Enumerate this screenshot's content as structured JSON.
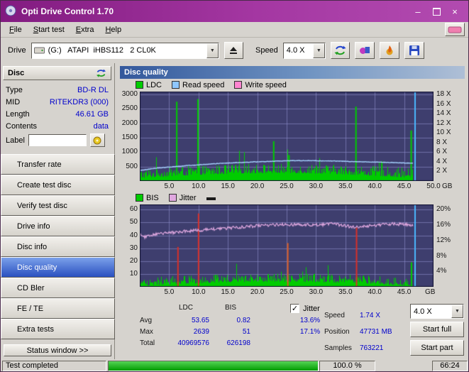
{
  "window": {
    "title": "Opti Drive Control 1.70"
  },
  "icons": {
    "minimize": "–",
    "close": "×",
    "dropdown": "▼",
    "check": "✓"
  },
  "menu": {
    "items": [
      "File",
      "Start test",
      "Extra",
      "Help"
    ]
  },
  "toolbar": {
    "drive_label": "Drive",
    "drive_value": "(G:)   ATAPI  iHBS112   2 CL0K",
    "speed_label": "Speed",
    "speed_value": "4.0 X"
  },
  "sidebar": {
    "header": "Disc",
    "info_rows": [
      {
        "label": "Type",
        "value": "BD-R DL"
      },
      {
        "label": "MID",
        "value": "RITEKDR3 (000)"
      },
      {
        "label": "Length",
        "value": "46.61 GB"
      },
      {
        "label": "Contents",
        "value": "data"
      }
    ],
    "label_row": {
      "label": "Label",
      "value": ""
    },
    "buttons": [
      {
        "label": "Transfer rate",
        "selected": false
      },
      {
        "label": "Create test disc",
        "selected": false
      },
      {
        "label": "Verify test disc",
        "selected": false
      },
      {
        "label": "Drive info",
        "selected": false
      },
      {
        "label": "Disc info",
        "selected": false
      },
      {
        "label": "Disc quality",
        "selected": true
      },
      {
        "label": "CD Bler",
        "selected": false
      },
      {
        "label": "FE / TE",
        "selected": false
      },
      {
        "label": "Extra tests",
        "selected": false
      }
    ],
    "status_window_button": "Status window >>"
  },
  "main": {
    "panel_title": "Disc quality",
    "results": {
      "col_headers": [
        "LDC",
        "BIS"
      ],
      "rows": [
        {
          "label": "Avg",
          "ldc": "53.65",
          "bis": "0.82",
          "jitter": "13.6%"
        },
        {
          "label": "Max",
          "ldc": "2639",
          "bis": "51",
          "jitter": "17.1%"
        },
        {
          "label": "Total",
          "ldc": "40969576",
          "bis": "626198",
          "jitter": ""
        }
      ],
      "jitter_checkbox": {
        "label": "Jitter",
        "checked": true
      },
      "stats": [
        {
          "label": "Speed",
          "value": "1.74 X"
        },
        {
          "label": "Position",
          "value": "47731 MB"
        },
        {
          "label": "Samples",
          "value": "763221"
        }
      ],
      "speed_select": "4.0 X",
      "start_full": "Start full",
      "start_part": "Start part"
    }
  },
  "statusbar": {
    "status": "Test completed",
    "progress_percent": 100,
    "percent_label": "100.0 %",
    "time": "66:24"
  },
  "chart_data": [
    {
      "type": "bar",
      "title": "Disc quality - LDC vs position",
      "legend": [
        {
          "label": "LDC",
          "color": "#00cc00"
        },
        {
          "label": "Read speed",
          "color": "#8fc7ff"
        },
        {
          "label": "Write speed",
          "color": "#ff85d0"
        }
      ],
      "x": {
        "min": 0,
        "max": 50,
        "unit": "GB",
        "ticks": [
          [
            5,
            "5.0"
          ],
          [
            10,
            "10.0"
          ],
          [
            15,
            "15.0"
          ],
          [
            20,
            "20.0"
          ],
          [
            25,
            "25.0"
          ],
          [
            30,
            "30.0"
          ],
          [
            35,
            "35.0"
          ],
          [
            40,
            "40.0"
          ],
          [
            45,
            "45.0"
          ],
          [
            50,
            "50.0"
          ]
        ]
      },
      "y_left": {
        "display_max": 3100,
        "ticks": [
          [
            3000,
            "3000"
          ],
          [
            2500,
            "2500"
          ],
          [
            2000,
            "2000"
          ],
          [
            1500,
            "1500"
          ],
          [
            1000,
            "1000"
          ],
          [
            500,
            "500"
          ]
        ]
      },
      "y_right": {
        "per_left": 166.67,
        "ticks": [
          [
            18,
            "18 X"
          ],
          [
            16,
            "16 X"
          ],
          [
            14,
            "14 X"
          ],
          [
            12,
            "12 X"
          ],
          [
            10,
            "10 X"
          ],
          [
            8,
            "8 X"
          ],
          [
            6,
            "6 X"
          ],
          [
            4,
            "4 X"
          ],
          [
            2,
            "2 X"
          ]
        ]
      },
      "data_end": 46.6,
      "seed": 1234,
      "bars": {
        "color": "#00cc00",
        "base": 110,
        "vary": 330,
        "bump": 170,
        "spikes": [
          [
            6.3,
            2750
          ],
          [
            9.9,
            2840
          ],
          [
            22.8,
            1380
          ],
          [
            25.4,
            900
          ],
          [
            36.8,
            2580
          ],
          [
            41.2,
            680
          ],
          [
            46.2,
            1750
          ]
        ]
      },
      "lines": [
        {
          "name": "read-speed",
          "color": "#a6d2ff",
          "width": 1.4,
          "scale": 166.67,
          "noise": 0.05,
          "x": [
            0,
            3,
            8,
            14,
            20,
            26,
            32,
            38,
            43,
            46.6
          ],
          "v": [
            2.2,
            2.7,
            3.2,
            3.7,
            4.0,
            4.25,
            4.2,
            4.0,
            3.85,
            3.7
          ]
        }
      ],
      "colors": {
        "bg": "#3e3e6e",
        "grid": "rgba(150,150,215,0.55)",
        "end": "#49b8ff"
      }
    },
    {
      "type": "bar",
      "title": "Disc quality - BIS / Jitter vs position",
      "legend": [
        {
          "label": "BIS",
          "color": "#00cc00"
        },
        {
          "label": "Jitter",
          "color": "#e0a8e0"
        },
        {
          "label": "",
          "color": "#1a1a1a"
        }
      ],
      "x": {
        "min": 0,
        "max": 50,
        "unit": "GB",
        "ticks": [
          [
            5,
            "5.0"
          ],
          [
            10,
            "10.0"
          ],
          [
            15,
            "15.0"
          ],
          [
            20,
            "20.0"
          ],
          [
            25,
            "25.0"
          ],
          [
            30,
            "30.0"
          ],
          [
            35,
            "35.0"
          ],
          [
            40,
            "40.0"
          ],
          [
            45,
            "45.0"
          ]
        ]
      },
      "y_left": {
        "display_max": 64,
        "ticks": [
          [
            60,
            "60"
          ],
          [
            50,
            "50"
          ],
          [
            40,
            "40"
          ],
          [
            30,
            "30"
          ],
          [
            20,
            "20"
          ],
          [
            10,
            "10"
          ]
        ]
      },
      "y_right": {
        "per_left": 3.0,
        "ticks": [
          [
            20,
            "20%"
          ],
          [
            16,
            "16%"
          ],
          [
            12,
            "12%"
          ],
          [
            8,
            "8%"
          ],
          [
            4,
            "4%"
          ]
        ]
      },
      "data_end": 46.6,
      "seed": 77,
      "bars": {
        "color": "#00cc00",
        "base": 0.8,
        "vary": 6.5,
        "bump": 3.2,
        "spikes": [
          [
            46.25,
            19
          ]
        ]
      },
      "error_spikes": [
        [
          6.5,
          31,
          "#d83028"
        ],
        [
          10.0,
          57,
          "#d83028"
        ],
        [
          25.2,
          34,
          "#d85a20"
        ],
        [
          36.9,
          46,
          "#d83028"
        ]
      ],
      "lines": [
        {
          "name": "jitter",
          "color": "#e0a8e0",
          "width": 1.2,
          "scale": 1,
          "noise": 1.2,
          "x": [
            0,
            1,
            2.5,
            5,
            10,
            15,
            20,
            25,
            30,
            33,
            36,
            39,
            43,
            46.6
          ],
          "v": [
            41,
            38.5,
            40.5,
            42,
            44,
            45.5,
            47.5,
            48.5,
            48,
            49,
            46.5,
            47.5,
            49,
            48
          ]
        }
      ],
      "colors": {
        "bg": "#3e3e6e",
        "grid": "rgba(150,150,215,0.55)",
        "end": "#49b8ff"
      }
    }
  ]
}
